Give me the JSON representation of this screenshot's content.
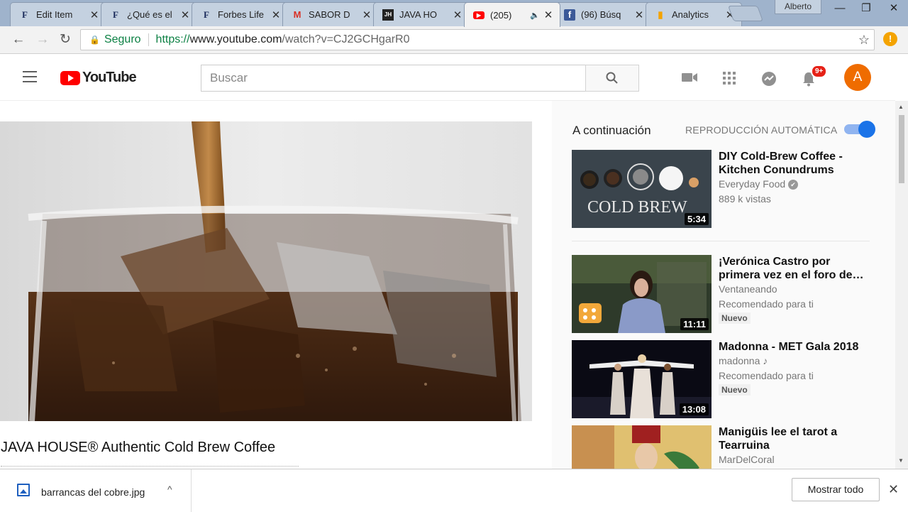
{
  "browser": {
    "tabs": [
      {
        "title": "Edit Item",
        "icon": "forbes-icon",
        "glyph": "F",
        "active": false
      },
      {
        "title": "¿Qué es el",
        "icon": "forbes-icon",
        "glyph": "F",
        "active": false
      },
      {
        "title": "Forbes Life",
        "icon": "forbes-icon",
        "glyph": "F",
        "active": false
      },
      {
        "title": "SABOR D",
        "icon": "gmail-icon",
        "glyph": "M",
        "active": false
      },
      {
        "title": "JAVA HO",
        "icon": "javahouse-icon",
        "glyph": "JH",
        "active": false
      },
      {
        "title": "(205)",
        "icon": "youtube-icon",
        "glyph": "▶",
        "active": true,
        "audio": "🔈"
      },
      {
        "title": "(96) Búsq",
        "icon": "facebook-icon",
        "glyph": "f",
        "active": false
      },
      {
        "title": "Analytics",
        "icon": "analytics-icon",
        "glyph": "▮",
        "active": false
      }
    ],
    "tab_close": "✕",
    "profile_name": "Alberto",
    "window_controls": {
      "minimize": "—",
      "maximize": "❐",
      "close": "✕"
    },
    "nav": {
      "back": "←",
      "forward": "→",
      "reload": "↻"
    },
    "security_label": "Seguro",
    "url_scheme": "https://",
    "url_domain": "www.youtube.com",
    "url_path": "/watch?v=CJ2GCHgarR0",
    "star": "☆",
    "extension_badge": "!"
  },
  "youtube": {
    "logo_text": "YouTube",
    "search_placeholder": "Buscar",
    "search_icon": "🔍",
    "notifications_badge": "9+",
    "avatar_letter": "A",
    "header_icons": {
      "upload": "■",
      "apps": "⋮⋮",
      "messages": "➤",
      "bell": "🔔"
    }
  },
  "video": {
    "title": "JAVA HOUSE® Authentic Cold Brew Coffee"
  },
  "sidebar": {
    "up_next_label": "A continuación",
    "autoplay_label": "REPRODUCCIÓN AUTOMÁTICA",
    "autoplay_on": true,
    "videos": [
      {
        "title": "DIY Cold-Brew Coffee - Kitchen Conundrums with…",
        "channel": "Everyday Food",
        "verified": "✔",
        "meta": "889 k vistas",
        "duration": "5:34",
        "badge": "",
        "thumb_text": "COLD BREW"
      },
      {
        "title": "¡Verónica Castro por primera vez en el foro de…",
        "channel": "Ventaneando",
        "meta": "Recomendado para ti",
        "duration": "11:11",
        "badge": "Nuevo"
      },
      {
        "title": "Madonna - MET Gala 2018",
        "channel": "madonna",
        "music": "♪",
        "meta": "Recomendado para ti",
        "duration": "13:08",
        "badge": "Nuevo"
      },
      {
        "title": "Manigüis lee el tarot a Tearruina",
        "channel": "MarDelCoral",
        "meta": "",
        "duration": "",
        "badge": ""
      }
    ]
  },
  "downloads": {
    "file_name": "barrancas del cobre.jpg",
    "chevron": "^",
    "show_all_label": "Mostrar todo",
    "close": "✕"
  },
  "colors": {
    "youtube_red": "#ff0000",
    "secure_green": "#0b8043",
    "toggle_blue": "#1a73e8",
    "avatar_orange": "#ef6c00"
  }
}
